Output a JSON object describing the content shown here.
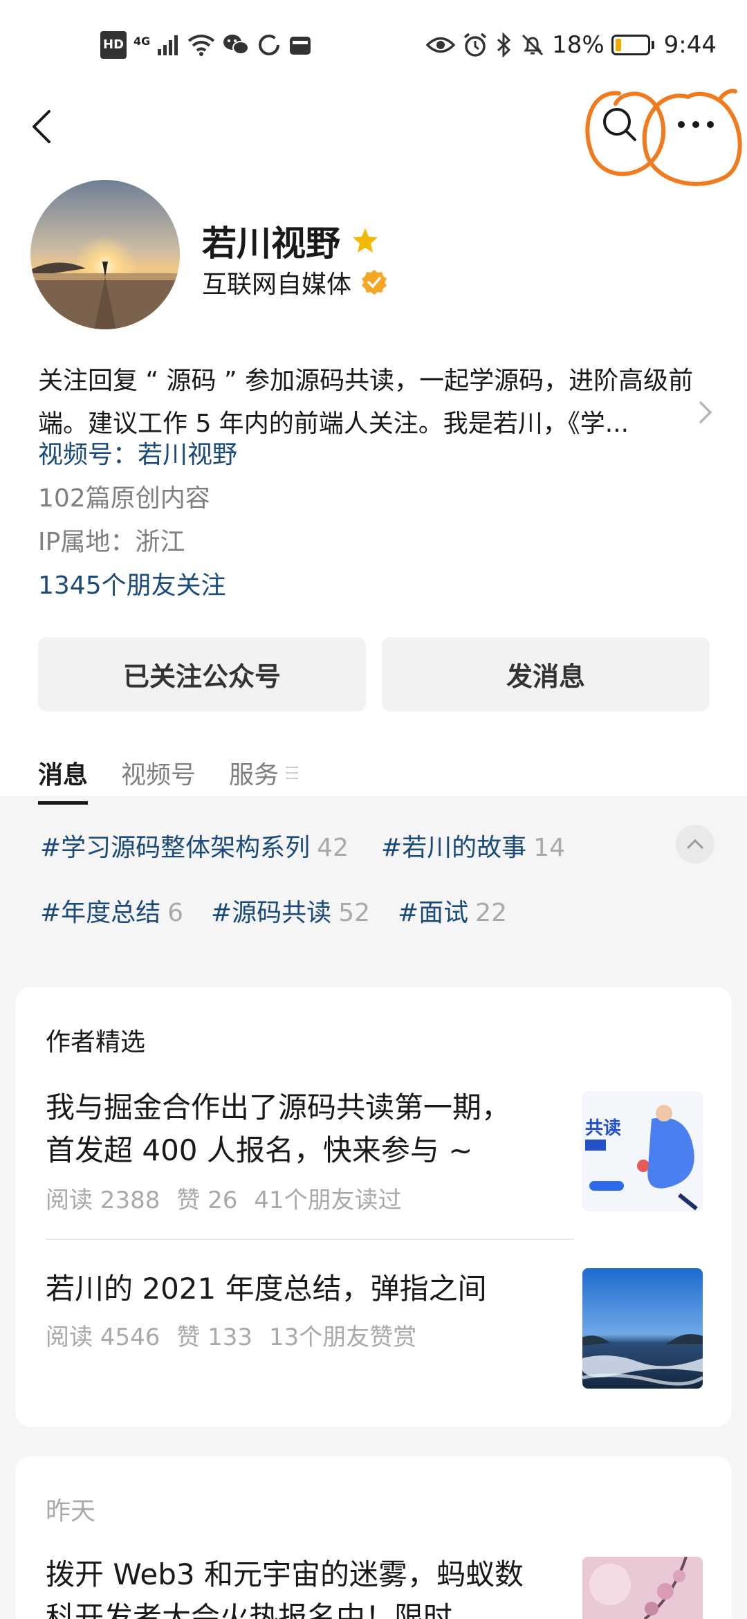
{
  "status_bar": {
    "hd_label": "HD",
    "network_label": "4G",
    "battery_percent_text": "18%",
    "battery_level": 0.18,
    "battery_color": "#f2a900",
    "time": "9:44",
    "left_icons": [
      "hd-icon",
      "signal-icon",
      "wifi-icon",
      "wechat-icon",
      "loading-icon",
      "huawei-icon"
    ],
    "right_icons": [
      "eye-icon",
      "alarm-icon",
      "bluetooth-icon",
      "mute-icon"
    ]
  },
  "nav": {
    "back_icon": "back-arrow-icon",
    "search_icon": "search-icon",
    "more_icon": "more-dots-icon",
    "annotation_color": "#f07a1e"
  },
  "profile": {
    "name": "若川视野",
    "type": "互联网自媒体",
    "bio_line1": "关注回复 “ 源码 ” 参加源码共读，一起学源码，进阶高级前",
    "bio_line2": "端。建议工作 5 年内的前端人关注。我是若川，《学...",
    "channel": "视频号：若川视野",
    "original_count": "102篇原创内容",
    "ip_location": "IP属地：浙江",
    "friends_follow": "1345个朋友关注",
    "accent_link_color": "#1a4a7a",
    "star_color": "#f5b800",
    "verified_color": "#f5a623"
  },
  "actions": {
    "followed_label": "已关注公众号",
    "message_label": "发消息"
  },
  "tabs": [
    {
      "label": "消息",
      "active": true
    },
    {
      "label": "视频号",
      "active": false
    },
    {
      "label": "服务",
      "active": false
    }
  ],
  "tags": [
    {
      "label": "#学习源码整体架构系列",
      "count": "42"
    },
    {
      "label": "#若川的故事",
      "count": "14"
    },
    {
      "label": "#年度总结",
      "count": "6"
    },
    {
      "label": "#源码共读",
      "count": "52"
    },
    {
      "label": "#面试",
      "count": "22"
    }
  ],
  "featured": {
    "title": "作者精选",
    "articles": [
      {
        "title_line1": "我与掘金合作出了源码共读第一期，",
        "title_line2": "首发超 400 人报名，快来参与 ~",
        "reads": "阅读 2388",
        "likes": "赞 26",
        "social": "41个朋友读过",
        "thumb_text": "共读"
      },
      {
        "title_line1": "若川的 2021 年度总结，弹指之间",
        "reads": "阅读 4546",
        "likes": "赞 133",
        "social": "13个朋友赞赏"
      }
    ]
  },
  "recent": {
    "day_label": "昨天",
    "article": {
      "title_line1": "拨开 Web3 和元宇宙的迷雾，蚂蚁数",
      "title_line2": "科开发者大会火热报名中！限时..."
    }
  }
}
